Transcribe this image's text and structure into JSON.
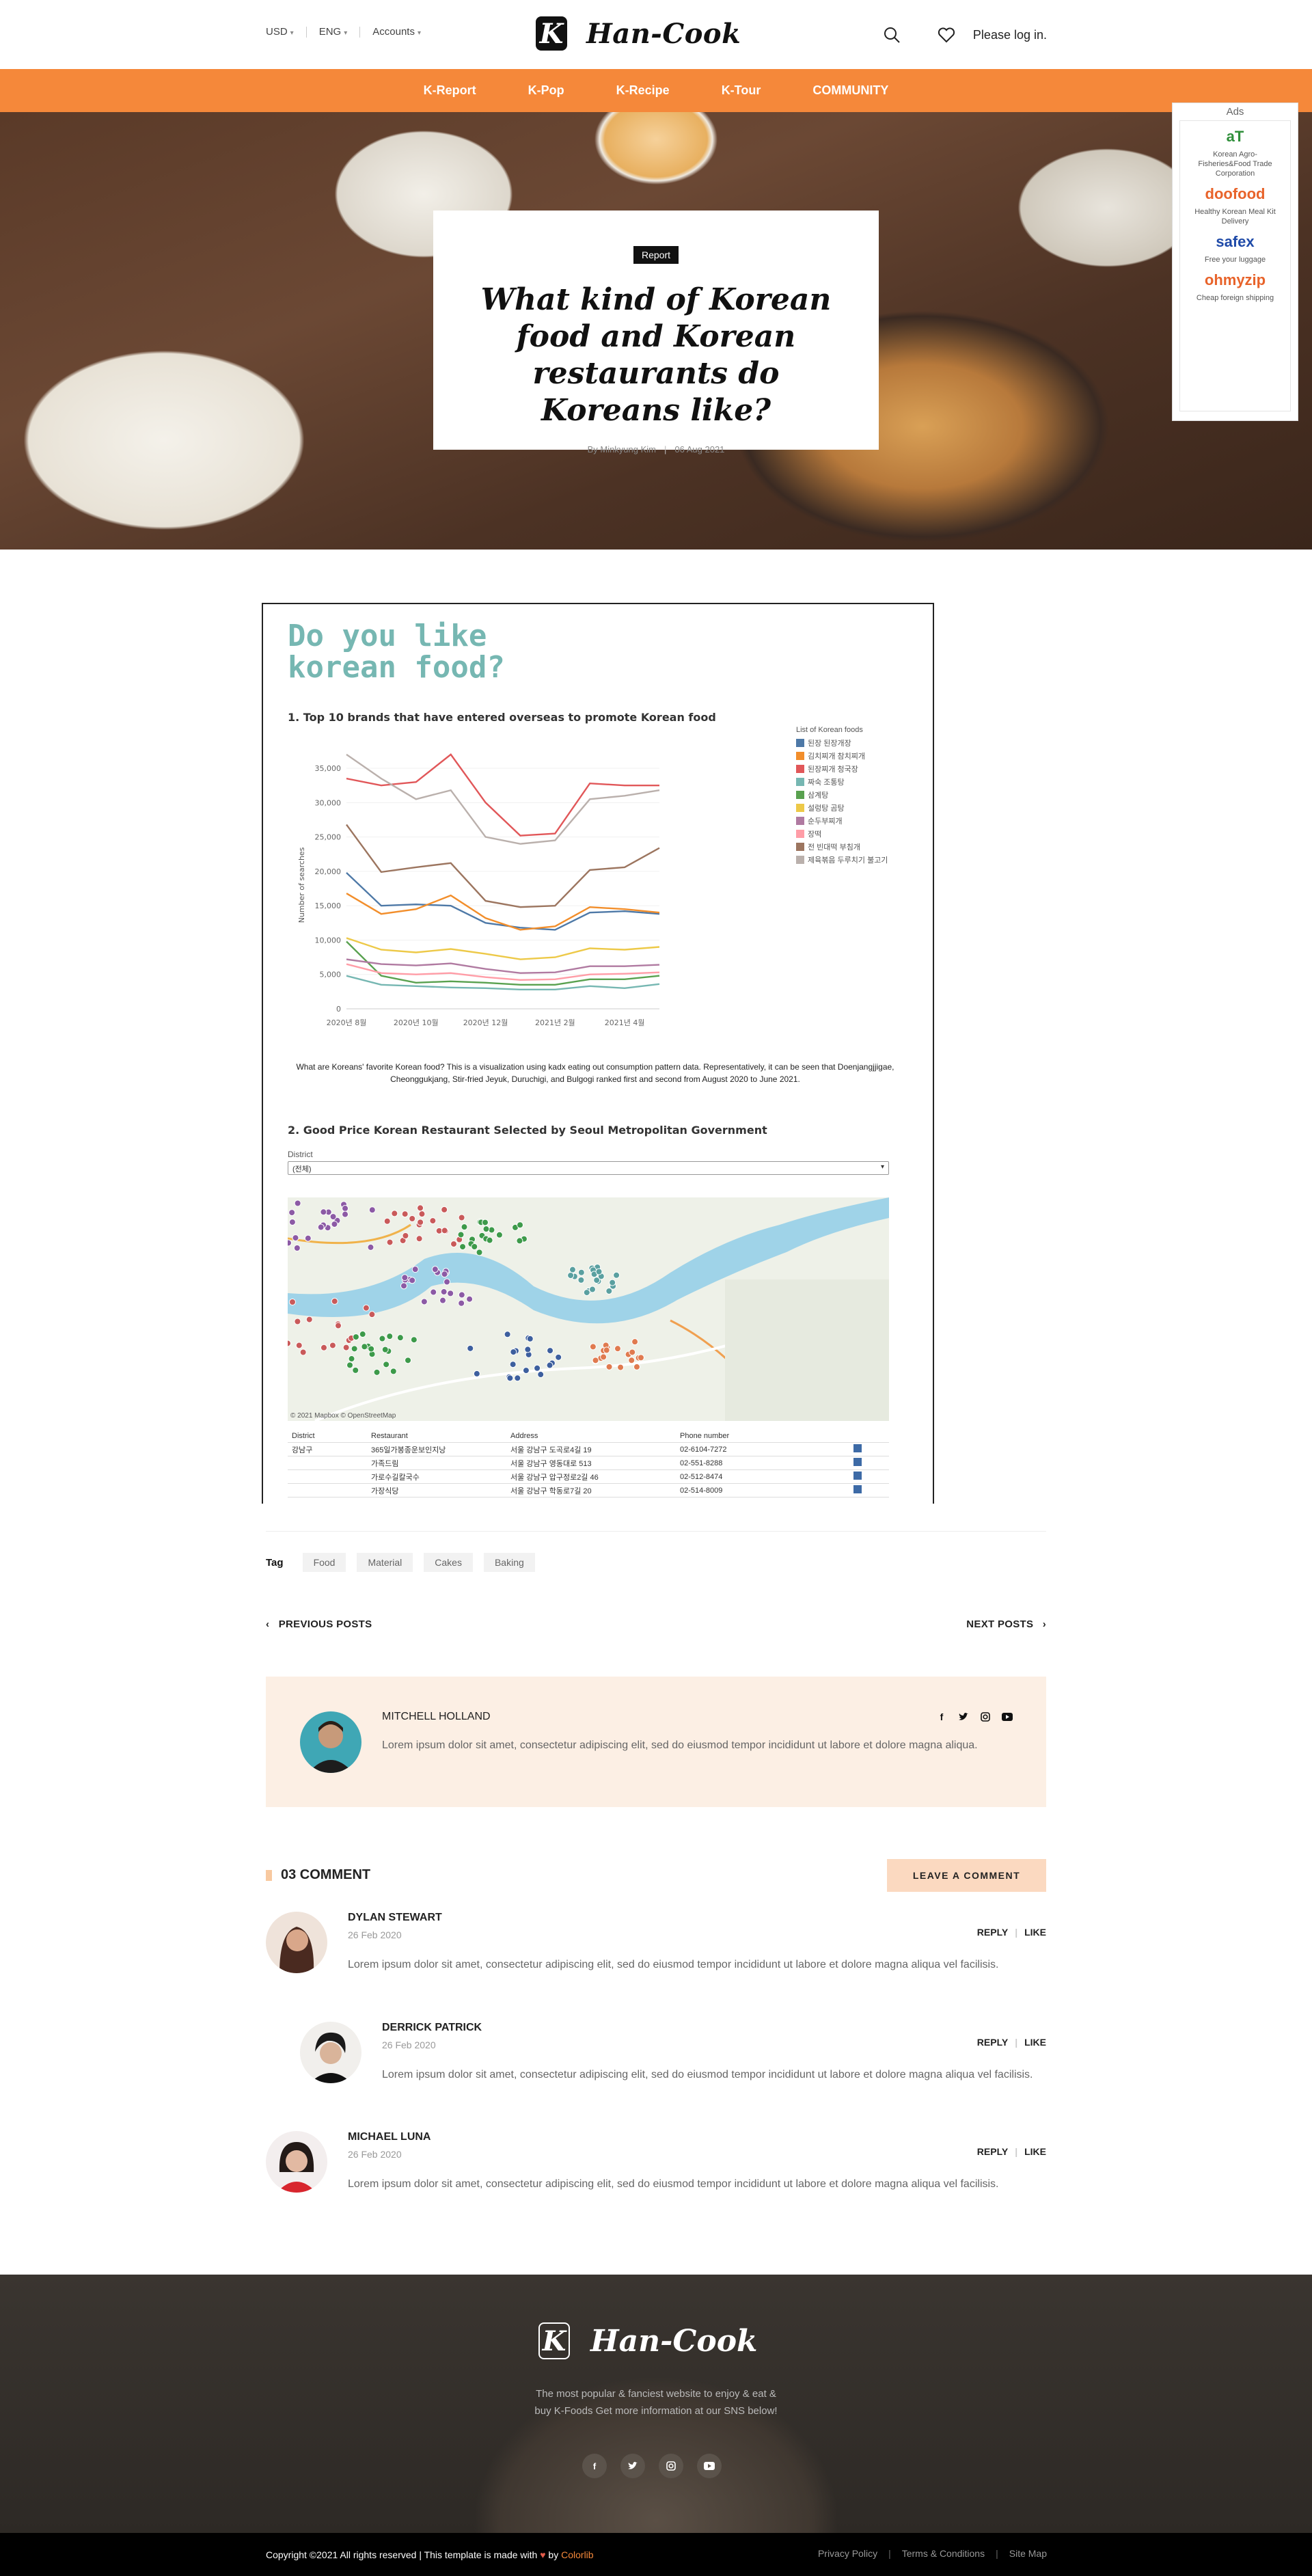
{
  "header": {
    "currency": "USD",
    "language": "ENG",
    "accounts": "Accounts",
    "logo_text": "Han-Cook",
    "login": "Please log in."
  },
  "nav": [
    "K-Report",
    "K-Pop",
    "K-Recipe",
    "K-Tour",
    "COMMUNITY"
  ],
  "hero": {
    "badge": "Report",
    "title": "What kind of Korean food and Korean restaurants do Koreans like?",
    "author": "By Minkyung Kim",
    "date": "06 Aug 2021"
  },
  "ads": {
    "title": "Ads",
    "items": [
      {
        "logo": "aT",
        "text": "Korean Agro-Fisheries&Food Trade Corporation",
        "color": "#2f8f3a"
      },
      {
        "logo": "doofood",
        "text": "Healthy Korean Meal Kit Delivery",
        "color": "#e8632a"
      },
      {
        "logo": "safex",
        "text": "Free your luggage",
        "color": "#1f4aa8"
      },
      {
        "logo": "ohmyzip",
        "text": "Cheap foreign shipping",
        "color": "#e8632a"
      }
    ]
  },
  "article": {
    "viz_title_line1": "Do you like",
    "viz_title_line2": "korean food?",
    "section1": "1. Top 10 brands that have entered overseas to promote Korean food",
    "paragraph": "What are Koreans' favorite Korean food? This is a visualization using kadx eating out consumption pattern data. Representatively, it can be seen that Doenjangjjigae, Cheonggukjang, Stir-fried Jeyuk, Duruchigi, and Bulgogi ranked first and second from August 2020 to June 2021.",
    "section2": "2. Good Price Korean Restaurant Selected by Seoul Metropolitan Government",
    "district_label": "District",
    "district_value": "(전체)",
    "map_attribution": "© 2021 Mapbox © OpenStreetMap",
    "table": {
      "headers": [
        "District",
        "Restaurant",
        "Address",
        "Phone number"
      ],
      "district": "강남구",
      "rows": [
        {
          "name": "365일가봉종운보인지낭",
          "address": "서울 강남구 도곡로4길 19",
          "phone": "02-6104-7272"
        },
        {
          "name": "가족드림",
          "address": "서울 강남구 영동대로 513",
          "phone": "02-551-8288"
        },
        {
          "name": "가로수길칼국수",
          "address": "서울 강남구 압구정로2길 46",
          "phone": "02-512-8474"
        },
        {
          "name": "가장식당",
          "address": "서울 강남구 학동로7길 20",
          "phone": "02-514-8009"
        }
      ]
    }
  },
  "chart_data": {
    "type": "line",
    "title": "",
    "xlabel": "",
    "ylabel": "Number of searches",
    "ylim": [
      0,
      36000
    ],
    "yticks": [
      "0",
      "5,000",
      "10,000",
      "15,000",
      "20,000",
      "25,000",
      "30,000",
      "35,000"
    ],
    "x": [
      "2020년 8월",
      "2020년 9월",
      "2020년 10월",
      "2020년 11월",
      "2020년 12월",
      "2021년 1월",
      "2021년 2월",
      "2021년 3월",
      "2021년 4월",
      "2021년 5월"
    ],
    "xtick_labels": [
      "2020년 8월",
      "2020년 10월",
      "2020년 12월",
      "2021년 2월",
      "2021년 4월"
    ],
    "legend_title": "List of Korean foods",
    "legend_position": "right",
    "series": [
      {
        "name": "된장 된장개장",
        "color": "#4e79a7",
        "values": [
          19800,
          15000,
          15200,
          15000,
          12500,
          11800,
          11500,
          14000,
          14200,
          13800
        ]
      },
      {
        "name": "김치찌개 참치찌개",
        "color": "#f28e2b",
        "values": [
          16800,
          13800,
          14500,
          16500,
          13200,
          11500,
          12000,
          14800,
          14500,
          14000
        ]
      },
      {
        "name": "된장찌개 청국장",
        "color": "#e15759",
        "values": [
          33500,
          32500,
          33000,
          37000,
          30000,
          25200,
          25500,
          32800,
          32500,
          32500
        ]
      },
      {
        "name": "짜숙 조통탕",
        "color": "#76b7b2",
        "values": [
          4800,
          3500,
          3300,
          3100,
          3000,
          2800,
          2800,
          3300,
          3000,
          3600
        ]
      },
      {
        "name": "삼계탕",
        "color": "#59a14f",
        "values": [
          9800,
          4800,
          3800,
          4000,
          3800,
          3500,
          3500,
          4300,
          4300,
          4800
        ]
      },
      {
        "name": "설렁탕 곰탕",
        "color": "#edc948",
        "values": [
          10300,
          8600,
          8200,
          8700,
          8000,
          7200,
          7500,
          8800,
          8600,
          9000
        ]
      },
      {
        "name": "순두부찌개",
        "color": "#b07aa1",
        "values": [
          7200,
          6500,
          6300,
          6600,
          5800,
          5200,
          5300,
          6200,
          6200,
          6400
        ]
      },
      {
        "name": "장떡",
        "color": "#ff9da7",
        "values": [
          6500,
          5200,
          5000,
          5200,
          4600,
          4200,
          4300,
          5000,
          5100,
          5300
        ]
      },
      {
        "name": "전 빈대떡 부침개",
        "color": "#9c755f",
        "values": [
          26800,
          19900,
          20600,
          21200,
          15700,
          14800,
          15000,
          20200,
          20600,
          23400
        ]
      },
      {
        "name": "제육볶음 두루치기 불고기",
        "color": "#bab0ac",
        "values": [
          37000,
          33500,
          30500,
          31800,
          25000,
          24000,
          24500,
          30500,
          31000,
          31800
        ]
      }
    ]
  },
  "tags": {
    "label": "Tag",
    "items": [
      "Food",
      "Material",
      "Cakes",
      "Baking"
    ]
  },
  "pager": {
    "previous": "PREVIOUS POSTS",
    "next": "NEXT POSTS"
  },
  "author": {
    "name": "MITCHELL HOLLAND",
    "bio": "Lorem ipsum dolor sit amet, consectetur adipiscing elit, sed do eiusmod tempor incididunt ut labore et dolore magna aliqua.",
    "social": [
      "f",
      "t",
      "ig",
      "yt"
    ]
  },
  "comments": {
    "title": "03 COMMENT",
    "leave_button": "LEAVE A COMMENT",
    "reply": "REPLY",
    "like": "LIKE",
    "items": [
      {
        "name": "DYLAN STEWART",
        "date": "26 Feb 2020",
        "text": "Lorem ipsum dolor sit amet, consectetur adipiscing elit, sed do eiusmod tempor incididunt ut labore et dolore magna aliqua vel facilisis."
      },
      {
        "name": "DERRICK PATRICK",
        "date": "26 Feb 2020",
        "text": "Lorem ipsum dolor sit amet, consectetur adipiscing elit, sed do eiusmod tempor incididunt ut labore et dolore magna aliqua vel facilisis."
      },
      {
        "name": "MICHAEL LUNA",
        "date": "26 Feb 2020",
        "text": "Lorem ipsum dolor sit amet, consectetur adipiscing elit, sed do eiusmod tempor incididunt ut labore et dolore magna aliqua vel facilisis."
      }
    ]
  },
  "footer": {
    "logo_text": "Han-Cook",
    "description": "The most popular & fanciest website to enjoy & eat & buy K-Foods Get more information at our SNS below!",
    "social": [
      "f",
      "t",
      "ig",
      "yt"
    ],
    "copyright_pre": "Copyright ©2021 All rights reserved | This template is made with",
    "copyright_by": "by",
    "copyright_link": "Colorlib",
    "links": [
      "Privacy Policy",
      "Terms & Conditions",
      "Site Map"
    ]
  }
}
